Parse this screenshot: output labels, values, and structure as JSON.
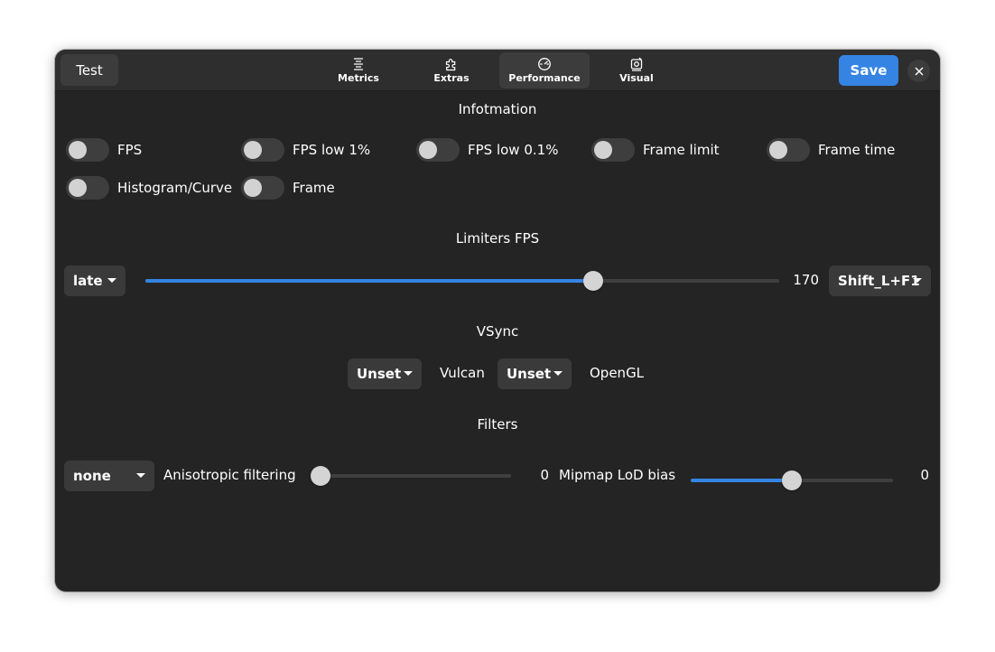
{
  "header": {
    "test_label": "Test",
    "save_label": "Save",
    "tabs": [
      {
        "label": "Metrics",
        "icon": "metrics-icon"
      },
      {
        "label": "Extras",
        "icon": "puzzle-icon"
      },
      {
        "label": "Performance",
        "icon": "performance-icon",
        "active": true
      },
      {
        "label": "Visual",
        "icon": "visual-icon"
      }
    ],
    "accent_color": "#3584e4"
  },
  "information": {
    "title": "Infotmation",
    "switches": [
      {
        "label": "FPS",
        "on": false
      },
      {
        "label": "FPS low 1%",
        "on": false
      },
      {
        "label": "FPS low 0.1%",
        "on": false
      },
      {
        "label": "Frame limit",
        "on": false
      },
      {
        "label": "Frame time",
        "on": false
      },
      {
        "label": "Histogram/Curve",
        "on": false
      },
      {
        "label": "Frame",
        "on": false
      }
    ]
  },
  "limiters": {
    "title": "Limiters FPS",
    "mode_value": "late",
    "fps_value": "170",
    "fps_fraction": 0.706,
    "keybind_value": "Shift_L+F1"
  },
  "vsync": {
    "title": "VSync",
    "vulkan_value": "Unset",
    "vulkan_label": "Vulcan",
    "opengl_value": "Unset",
    "opengl_label": "OpenGL"
  },
  "filters": {
    "title": "Filters",
    "filter_value": "none",
    "aniso_label": "Anisotropic filtering",
    "aniso_value": "0",
    "aniso_fraction": 0.0,
    "mipmap_label": "Mipmap LoD bias",
    "mipmap_value": "0",
    "mipmap_fraction": 0.5
  }
}
